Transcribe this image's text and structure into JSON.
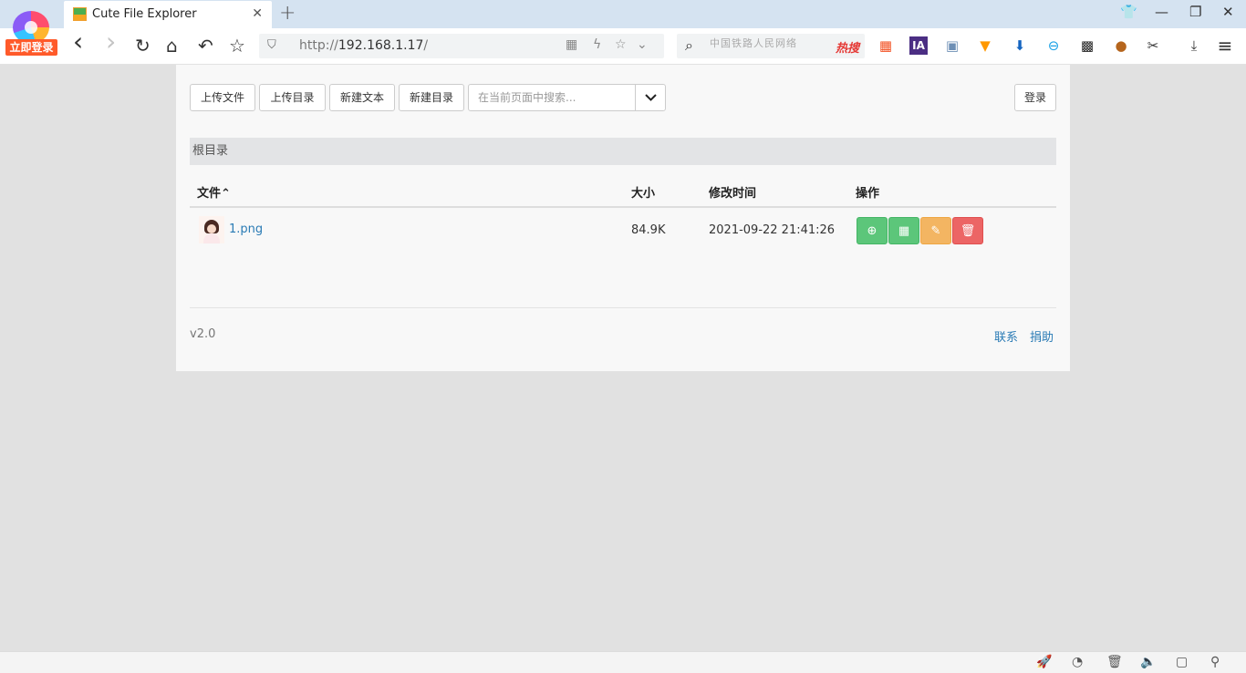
{
  "browser": {
    "login_badge": "立即登录",
    "tab": {
      "title": "Cute File Explorer"
    },
    "address": {
      "scheme": "http://",
      "host": "192.168.1.17",
      "path": "/"
    },
    "search": {
      "hint": "中国铁路人民网络",
      "hot_label": "热搜"
    },
    "icons": {
      "back": "‹",
      "forward": "›",
      "reload": "↻",
      "home": "⌂",
      "undo": "↶",
      "star": "☆",
      "close": "✕",
      "plus": "+",
      "shirt": "👕",
      "minimize": "—",
      "restore": "❐",
      "win_close": "✕",
      "shield": "⛉",
      "qr": "▦",
      "flash": "ϟ",
      "fav": "☆",
      "chevron": "⌄",
      "search": "⌕",
      "download": "⤓",
      "menu": "≡",
      "scissors": "✂"
    },
    "extensions": [
      {
        "name": "windows-ext-icon",
        "glyph": "▦",
        "color": "#f25022"
      },
      {
        "name": "ia-ext-icon",
        "glyph": "IA",
        "color": "#4b2e83"
      },
      {
        "name": "image-ext-icon",
        "glyph": "▣",
        "color": "#6d8fb5"
      },
      {
        "name": "fox-ext-icon",
        "glyph": "▼",
        "color": "#ff9800"
      },
      {
        "name": "cloud-download-ext-icon",
        "glyph": "⬇",
        "color": "#1565c0"
      },
      {
        "name": "minus-circle-ext-icon",
        "glyph": "⊖",
        "color": "#1aa1e6"
      },
      {
        "name": "qrcode-ext-icon",
        "glyph": "▩",
        "color": "#222222"
      },
      {
        "name": "monkey-ext-icon",
        "glyph": "●",
        "color": "#b5651d"
      }
    ]
  },
  "app": {
    "buttons": {
      "upload_file": "上传文件",
      "upload_dir": "上传目录",
      "new_text": "新建文本",
      "new_dir": "新建目录",
      "login": "登录"
    },
    "search_placeholder": "在当前页面中搜索...",
    "dropdown_icon": "⌄",
    "breadcrumb": "根目录",
    "table": {
      "headers": {
        "file": "文件",
        "sort_icon": "⌃",
        "size": "大小",
        "mtime": "修改时间",
        "ops": "操作"
      },
      "rows": [
        {
          "name": "1.png",
          "size": "84.9K",
          "mtime": "2021-09-22 21:41:26"
        }
      ],
      "action_icons": {
        "download": "⊕",
        "qr": "▦",
        "edit": "✎",
        "delete": "🗑"
      }
    },
    "footer": {
      "version": "v2.0",
      "contact": "联系",
      "donate": "捐助"
    }
  },
  "statusbar": {
    "icons": {
      "rocket": "🚀",
      "speed": "◔",
      "trash": "🗑",
      "volume": "🔈",
      "window": "▢",
      "zoom": "⚲"
    }
  }
}
